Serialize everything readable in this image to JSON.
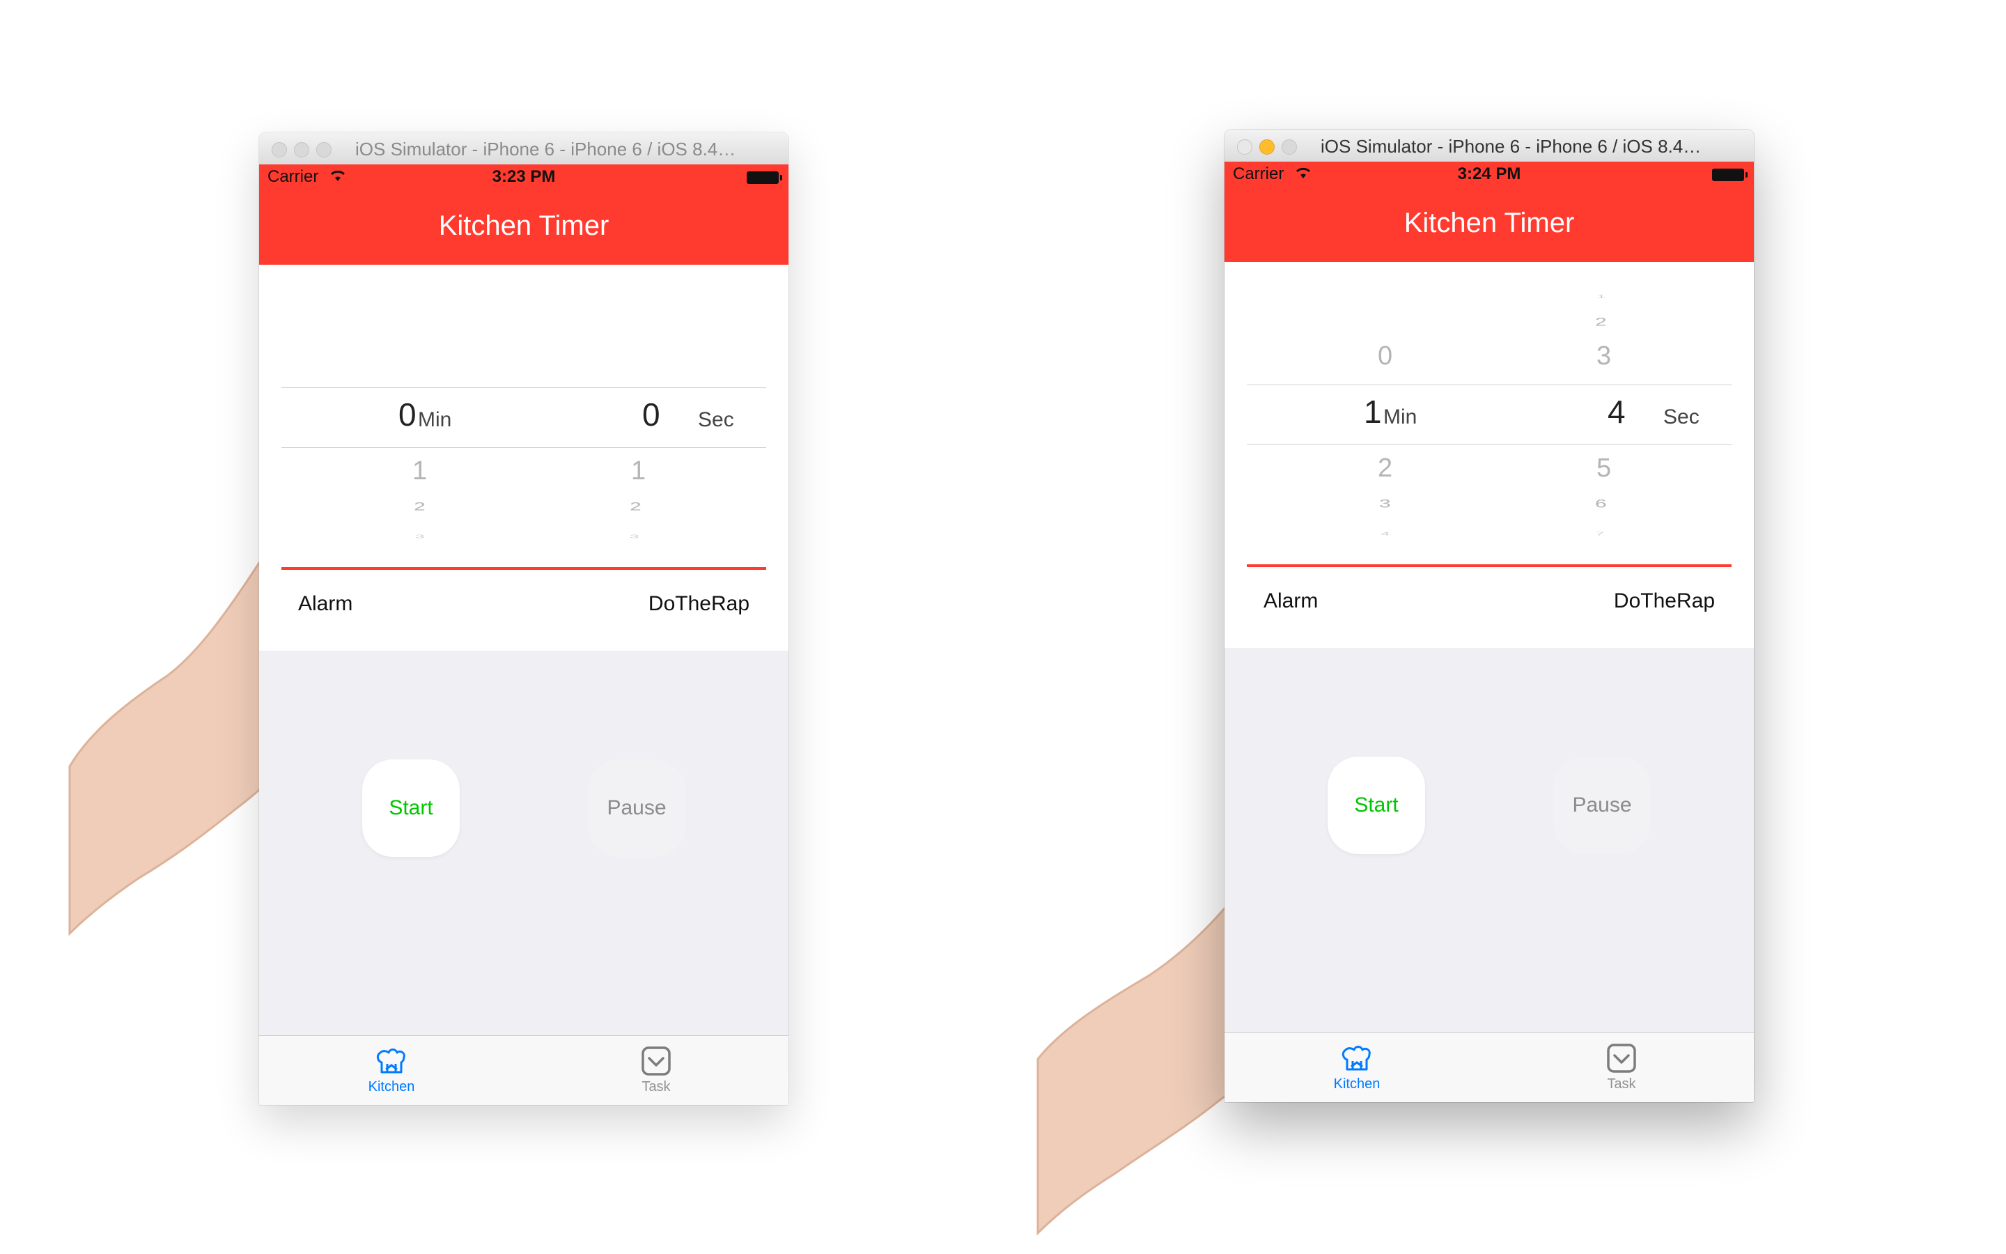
{
  "colors": {
    "accent": "#ff3b30",
    "start": "#00c600",
    "tab_active": "#007aff",
    "panel_bg": "#efeff4"
  },
  "screens": [
    {
      "window_title": "iOS Simulator - iPhone 6 - iPhone 6 / iOS 8.4…",
      "status": {
        "carrier": "Carrier",
        "time": "3:23 PM"
      },
      "app_title": "Kitchen Timer",
      "min_picker": {
        "selected": "0",
        "unit": "Min",
        "above": [
          "",
          "",
          ""
        ],
        "below": [
          "1",
          "2",
          "3"
        ]
      },
      "sec_picker": {
        "selected": "0",
        "unit": "Sec",
        "above": [
          "",
          "",
          ""
        ],
        "below": [
          "1",
          "2",
          "3"
        ]
      },
      "alarm": {
        "label": "Alarm",
        "value": "DoTheRap"
      },
      "buttons": {
        "start": "Start",
        "pause": "Pause"
      },
      "tabs": [
        {
          "label": "Kitchen",
          "icon": "chef-hat-icon"
        },
        {
          "label": "Task",
          "icon": "checkbox-icon"
        }
      ]
    },
    {
      "window_title": "iOS Simulator - iPhone 6 - iPhone 6 / iOS 8.4…",
      "status": {
        "carrier": "Carrier",
        "time": "3:24 PM"
      },
      "app_title": "Kitchen Timer",
      "min_picker": {
        "selected": "1",
        "unit": "Min",
        "above": [
          "0",
          "",
          ""
        ],
        "below": [
          "2",
          "3",
          "4"
        ]
      },
      "sec_picker": {
        "selected": "4",
        "unit": "Sec",
        "above": [
          "3",
          "2",
          "1"
        ],
        "below": [
          "5",
          "6",
          "7"
        ]
      },
      "alarm": {
        "label": "Alarm",
        "value": "DoTheRap"
      },
      "buttons": {
        "start": "Start",
        "pause": "Pause"
      },
      "tabs": [
        {
          "label": "Kitchen",
          "icon": "chef-hat-icon"
        },
        {
          "label": "Task",
          "icon": "checkbox-icon"
        }
      ]
    }
  ]
}
